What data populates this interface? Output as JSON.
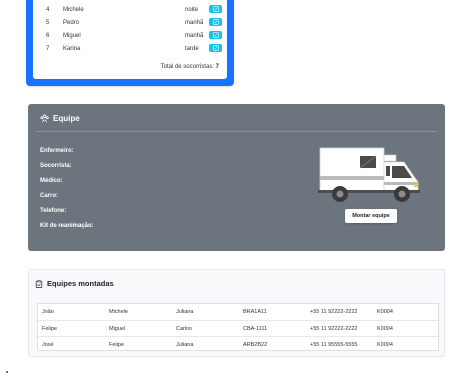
{
  "socorristas": {
    "rows": [
      {
        "num": "4",
        "name": "Michele",
        "turno": "noite"
      },
      {
        "num": "5",
        "name": "Pedro",
        "turno": "manhã"
      },
      {
        "num": "6",
        "name": "Miguel",
        "turno": "manhã"
      },
      {
        "num": "7",
        "name": "Karina",
        "turno": "tarde"
      }
    ],
    "total_label": "Total de socorristas:",
    "total_value": "7"
  },
  "equipe": {
    "title": "Equipe",
    "fields": [
      "Enfermeiro:",
      "Socorrista:",
      "Médico:",
      "Carro:",
      "Telefone:",
      "Kit de reanimação:"
    ],
    "button_label": "Montar equipe"
  },
  "montadas": {
    "title": "Equipes montadas",
    "rows": [
      [
        "João",
        "Michele",
        "Juliana",
        "BRA1A11",
        "+55 11 92222-2222",
        "K0004"
      ],
      [
        "Felipe",
        "Miguel",
        "Carlos",
        "CBA-1111",
        "+55 11 92222-2222",
        "K0004"
      ],
      [
        "José",
        "Felipe",
        "Juliana",
        "ARB2B22",
        "+55 11 95555-5555",
        "K0004"
      ]
    ]
  },
  "colors": {
    "primary": "#1a73ff",
    "info": "#17c1e8",
    "secondary": "#6c757d"
  },
  "icons": {
    "edit": "edit-icon",
    "team": "team-icon",
    "clipboard": "clipboard-icon",
    "ambulance": "ambulance-illustration"
  }
}
